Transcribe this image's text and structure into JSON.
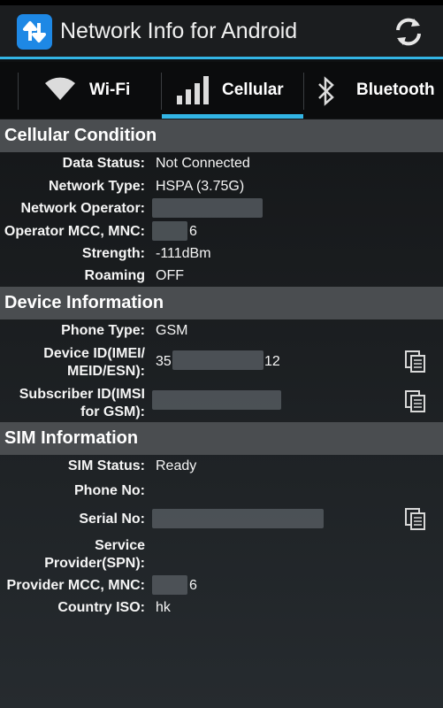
{
  "app": {
    "title": "Network Info for Android"
  },
  "tabs": [
    {
      "label": "Wi-Fi",
      "icon": "wifi-icon"
    },
    {
      "label": "Cellular",
      "icon": "signal-bars-icon"
    },
    {
      "label": "Bluetooth",
      "icon": "bluetooth-icon"
    }
  ],
  "active_tab": "Cellular",
  "cellular": {
    "header": "Cellular Condition",
    "data_status_label": "Data Status:",
    "data_status": "Not Connected",
    "network_type_label": "Network Type:",
    "network_type": "HSPA (3.75G)",
    "operator_label": "Network Operator:",
    "mcc_mnc_label": "Operator MCC, MNC:",
    "mcc_mnc_suffix": "6",
    "strength_label": "Strength:",
    "strength": "-111dBm",
    "roaming_label": "Roaming",
    "roaming": "OFF"
  },
  "device": {
    "header": "Device Information",
    "phone_type_label": "Phone Type:",
    "phone_type": "GSM",
    "device_id_label_1": "Device ID(IMEI/",
    "device_id_label_2": "MEID/ESN):",
    "device_id_prefix": "35",
    "device_id_suffix": "12",
    "subscriber_label_1": "Subscriber ID(IMSI",
    "subscriber_label_2": "for GSM):"
  },
  "sim": {
    "header": "SIM Information",
    "status_label": "SIM Status:",
    "status": "Ready",
    "phone_no_label": "Phone No:",
    "serial_label": "Serial No:",
    "spn_label_1": "Service",
    "spn_label_2": "Provider(SPN):",
    "provider_mcc_label": "Provider MCC, MNC:",
    "provider_mcc_suffix": "6",
    "country_label": "Country ISO:",
    "country": "hk"
  },
  "colors": {
    "accent": "#33b5e5",
    "section_bg": "#4a4d50",
    "logo": "#1e88e5"
  }
}
